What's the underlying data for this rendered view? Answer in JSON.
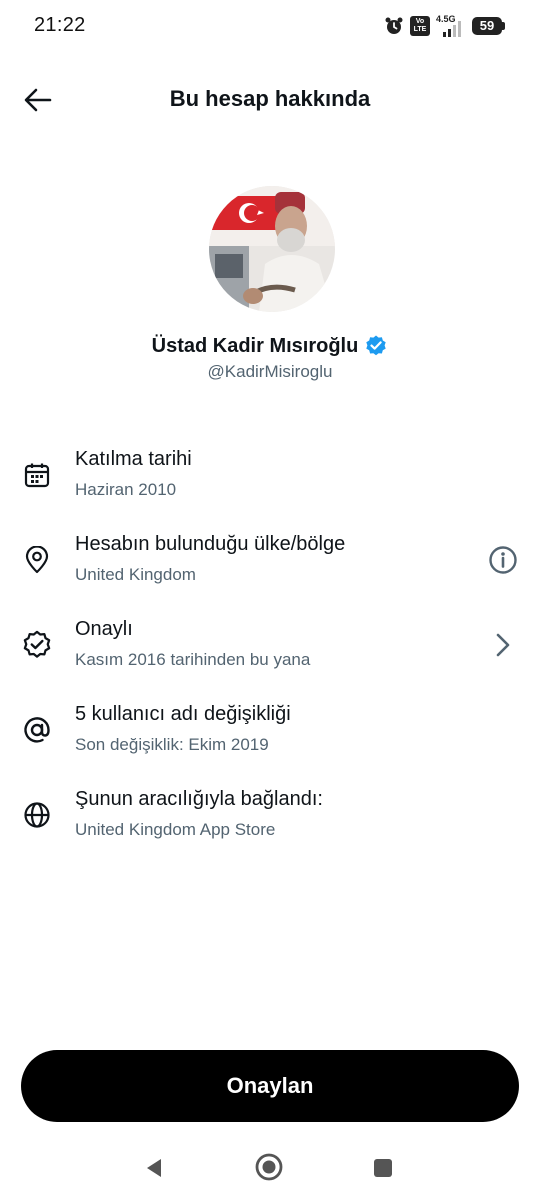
{
  "status_bar": {
    "time": "21:22",
    "volte_label": "Vo\nLTE",
    "network_type": "4.5G",
    "battery_percent": "59",
    "icons": [
      "alarm-icon",
      "volte-icon",
      "signal-icon",
      "battery-icon"
    ]
  },
  "header": {
    "title": "Bu hesap hakkında",
    "back_icon": "arrow-left-icon"
  },
  "profile": {
    "name": "Üstad Kadir Mısıroğlu",
    "handle": "@KadirMisiroglu",
    "verified": true,
    "verified_color": "#1d9bf0"
  },
  "info_rows": [
    {
      "icon": "calendar-icon",
      "title": "Katılma tarihi",
      "subtitle": "Haziran 2010"
    },
    {
      "icon": "location-pin-icon",
      "title": "Hesabın bulunduğu ülke/bölge",
      "subtitle": "United Kingdom",
      "trailing_icon": "info-icon"
    },
    {
      "icon": "verified-badge-outline-icon",
      "title": "Onaylı",
      "subtitle": "Kasım 2016 tarihinden bu yana",
      "trailing_icon": "chevron-right-icon"
    },
    {
      "icon": "at-sign-icon",
      "title": "5 kullanıcı adı değişikliği",
      "subtitle": "Son değişiklik: Ekim 2019"
    },
    {
      "icon": "globe-icon",
      "title": "Şunun aracılığıyla bağlandı:",
      "subtitle": "United Kingdom App Store"
    }
  ],
  "confirm_button": {
    "label": "Onaylan"
  },
  "colors": {
    "primary_text": "#0f1419",
    "secondary_text": "#536471",
    "button_bg": "#000000",
    "button_text": "#ffffff"
  },
  "nav_bar": {
    "icons": [
      "nav-back-icon",
      "nav-home-icon",
      "nav-recents-icon"
    ]
  }
}
